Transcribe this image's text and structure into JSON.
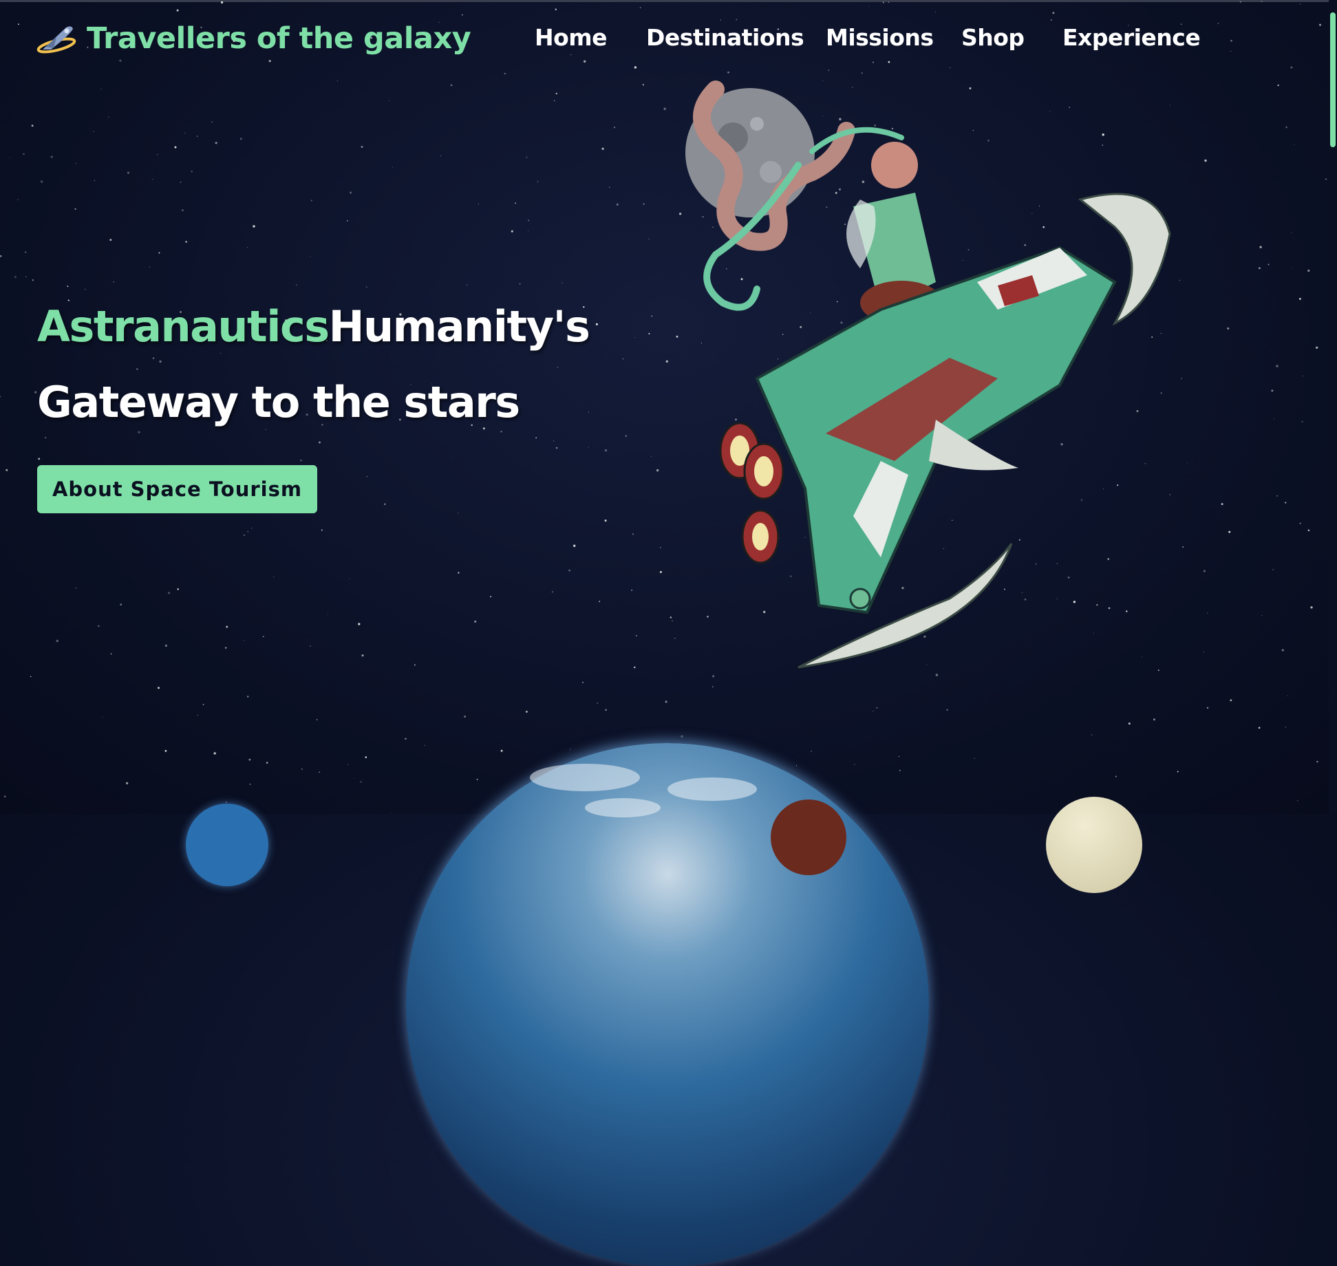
{
  "brand": {
    "name": "Travellers of the galaxy",
    "logo_icon": "rocket-ring-icon",
    "accent_color": "#7fe0a7"
  },
  "nav": {
    "items": [
      {
        "label": "Home"
      },
      {
        "label": "Destinations"
      },
      {
        "label": "Missions"
      },
      {
        "label": "Shop"
      },
      {
        "label": "Experience"
      }
    ]
  },
  "hero": {
    "highlight": "Astranautics",
    "title_rest": "Humanity's",
    "line2": "Gateway to the stars",
    "cta_label": "About Space Tourism",
    "illustration": "girl-riding-spacecraft-illustration"
  },
  "colors": {
    "background": "#0c1228",
    "accent": "#7fe0a7",
    "text": "#ffffff",
    "button_text": "#0b1020"
  }
}
